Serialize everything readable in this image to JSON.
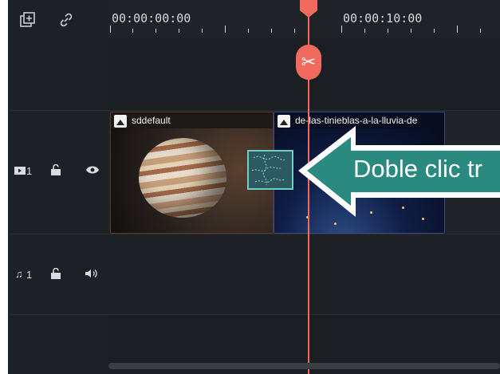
{
  "toolbar": {
    "add_track_icon": "add-track-icon",
    "link_icon": "link-icon"
  },
  "ruler": {
    "timecodes": [
      "00:00:00:00",
      "00:00:10:00"
    ]
  },
  "playhead": {
    "split_icon": "scissors-icon"
  },
  "tracks": {
    "video": {
      "number": "1",
      "lock_icon": "unlock-icon",
      "visibility_icon": "eye-icon",
      "clips": [
        {
          "name": "sddefault"
        },
        {
          "name": "de-las-tinieblas-a-la-lluvia-de"
        }
      ]
    },
    "audio": {
      "number": "1",
      "lock_icon": "unlock-icon",
      "volume_icon": "speaker-icon"
    }
  },
  "annotation": {
    "text": "Doble clic tr",
    "color": "#2a8a80"
  },
  "colors": {
    "playhead": "#f26a5e",
    "transition_border": "#6ecfc5"
  }
}
